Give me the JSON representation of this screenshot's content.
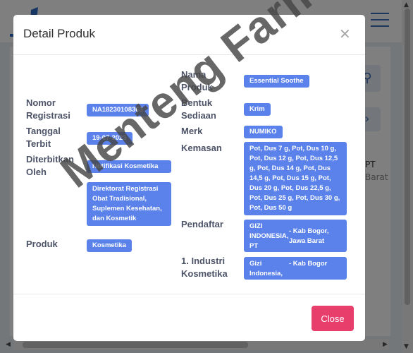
{
  "modal": {
    "title": "Detail Produk",
    "close_icon": "close-icon",
    "close_button_label": "Close"
  },
  "fields": {
    "nama_produk": {
      "label": "Nama Produk",
      "value": "Essential Soothe"
    },
    "nomor_registrasi": {
      "label": "Nomor Registrasi",
      "value": "NA18230108363"
    },
    "bentuk_sediaan": {
      "label": "Bentuk Sediaan",
      "value": "Krim"
    },
    "tanggal_terbit": {
      "label": "Tanggal Terbit",
      "value": "19-07-2023"
    },
    "merk": {
      "label": "Merk",
      "value": "NUMIKO"
    },
    "diterbitkan_oleh": {
      "label": "Diterbitkan Oleh",
      "value": "Notifikasi Kosmetika",
      "value2": "Direktorat Registrasi Obat Tradisional, Suplemen Kesehatan, dan Kosmetik"
    },
    "kemasan": {
      "label": "Kemasan",
      "value": "Pot, Dus 7 g, Pot, Dus 10 g, Pot, Dus 12 g, Pot, Dus 12,5 g, Pot, Dus 14 g, Pot, Dus 14,5 g, Pot, Dus 15 g, Pot, Dus 20 g, Pot, Dus 22,5 g, Pot, Dus 25 g, Pot, Dus 30 g, Pot, Dus 50 g"
    },
    "produk": {
      "label": "Produk",
      "value": "Kosmetika"
    },
    "pendaftar": {
      "label": "Pendaftar",
      "name": "GIZI INDONESIA, PT",
      "location": "- Kab Bogor, Jawa Barat"
    },
    "industri": {
      "label": "1. Industri Kosmetika",
      "name": "Gizi Indonesia, PT",
      "location": "- Kab Bogor"
    }
  },
  "watermark": "Menteng Farma",
  "background": {
    "text1": "PT",
    "text2": "Barat",
    "search_icon": "search-icon",
    "next_icon": "chevron-right-icon",
    "menu_icon": "hamburger-menu-icon"
  },
  "colors": {
    "chip": "#5b82ea",
    "close_button": "#e83e6c",
    "label": "#4d5468"
  }
}
